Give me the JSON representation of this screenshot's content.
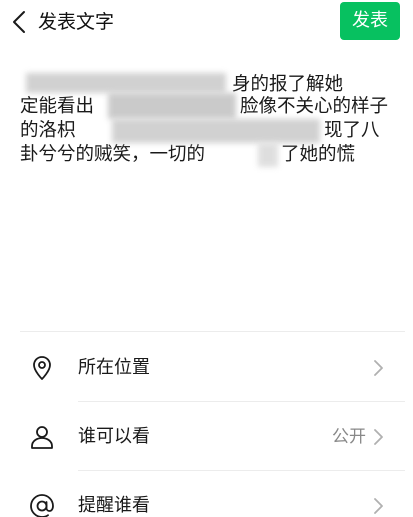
{
  "header": {
    "back_icon": "chevron-left-icon",
    "title": "发表文字",
    "publish_label": "发表"
  },
  "post": {
    "lines": [
      "身的报了解她",
      "定能看出 脸像不关心的样子",
      "的洛枳 现了八",
      "卦兮兮的贼笑，一切的 了她的慌"
    ],
    "line_fragments": {
      "l0_right": "身的报了解她",
      "l1_left": "定能看出",
      "l1_right": "脸像不关心的样子",
      "l2_left": "的洛枳",
      "l2_right": "现了八",
      "l3_left": "卦兮兮的贼笑，一切的",
      "l3_right": "了她的慌"
    }
  },
  "options": [
    {
      "icon": "location-pin-icon",
      "label": "所在位置",
      "value": "",
      "chevron_icon": "chevron-right-icon"
    },
    {
      "icon": "person-icon",
      "label": "谁可以看",
      "value": "公开",
      "chevron_icon": "chevron-right-icon"
    },
    {
      "icon": "at-sign-icon",
      "label": "提醒谁看",
      "value": "",
      "chevron_icon": "chevron-right-icon"
    }
  ],
  "colors": {
    "accent": "#07c160",
    "text": "#1a1a1a",
    "secondary_text": "#888888",
    "divider": "#ececec"
  }
}
